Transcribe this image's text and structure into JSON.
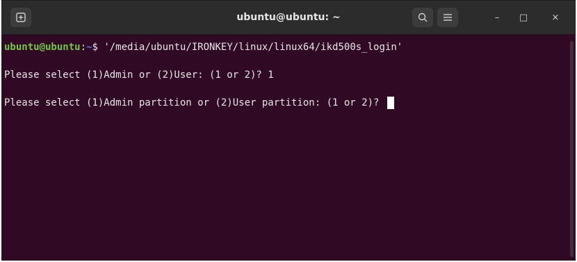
{
  "window": {
    "title": "ubuntu@ubuntu: ~"
  },
  "titlebar": {
    "icons": [
      "new-tab-icon",
      "search-icon",
      "hamburger-menu-icon",
      "minimize-icon",
      "maximize-icon",
      "close-icon"
    ],
    "minimize_glyph": "–",
    "maximize_glyph": "□",
    "close_glyph": "×"
  },
  "terminal": {
    "prompt_userhost": "ubuntu@ubuntu",
    "prompt_colon": ":",
    "prompt_path": "~",
    "prompt_symbol": "$ ",
    "command": "'/media/ubuntu/IRONKEY/linux/linux64/ikd500s_login'",
    "line2": "Please select (1)Admin or (2)User: (1 or 2)? 1",
    "line3": "Please select (1)Admin partition or (2)User partition: (1 or 2)? "
  },
  "colors": {
    "background": "#300a24",
    "titlebar": "#2c2c2c",
    "userhost": "#73c73f",
    "path": "#4c86d9",
    "text": "#e6e6e6"
  }
}
